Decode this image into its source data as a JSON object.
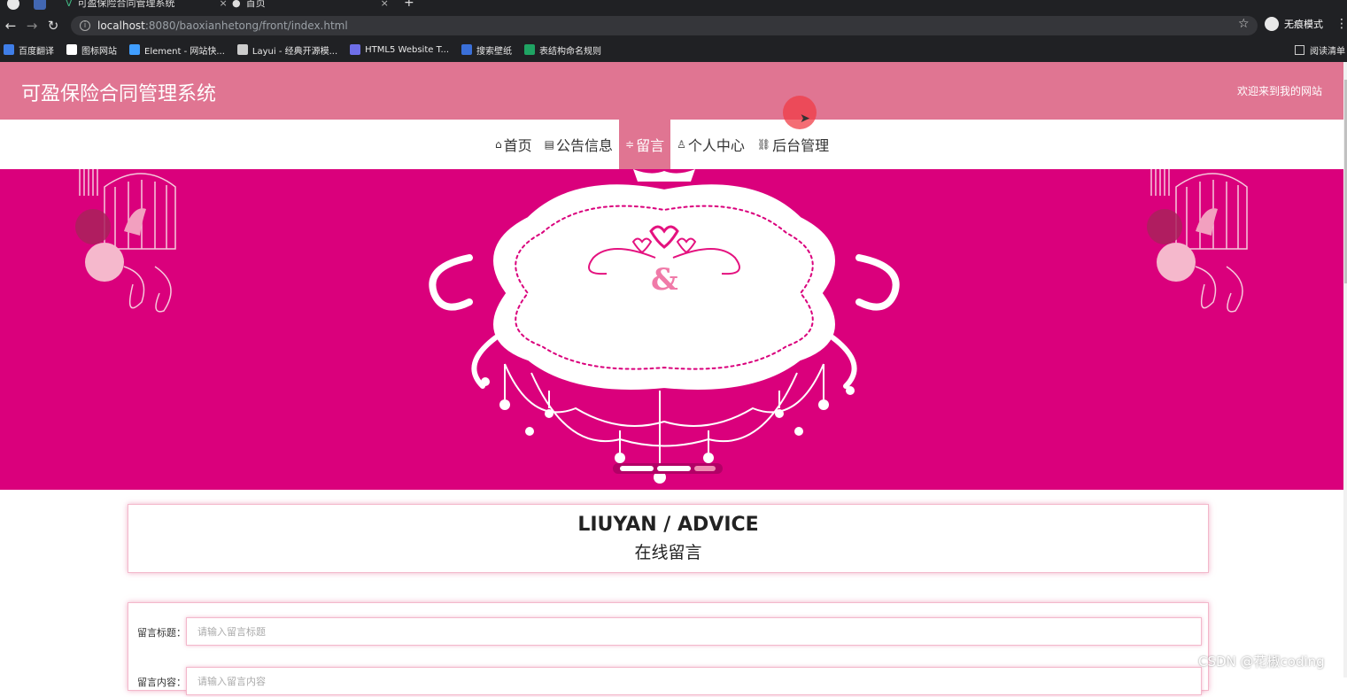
{
  "browser": {
    "tabs": [
      {
        "label": "可盈保险合同管理系统",
        "close": "×"
      },
      {
        "label": "首页",
        "close": "×"
      }
    ],
    "new_tab": "+",
    "nav": {
      "back": "←",
      "forward": "→",
      "reload": "↻"
    },
    "url_host": "localhost",
    "url_path": ":8080/baoxianhetong/front/index.html",
    "star": "☆",
    "incognito_label": "无痕模式",
    "menu": "⋮",
    "bookmarks": [
      {
        "label": "百度翻译",
        "color": "#3f7ee8"
      },
      {
        "label": "图标网站",
        "color": "#ffffff"
      },
      {
        "label": "Element - 网站快...",
        "color": "#409eff"
      },
      {
        "label": "Layui - 经典开源模...",
        "color": "#cccccc"
      },
      {
        "label": "HTML5 Website T...",
        "color": "#6e6ee8"
      },
      {
        "label": "搜索壁纸",
        "color": "#3a6fd8"
      },
      {
        "label": "表结构命名规则",
        "color": "#1fa463"
      }
    ],
    "reading_list": "阅读清单"
  },
  "site": {
    "title": "可盈保险合同管理系统",
    "welcome": "欢迎来到我的网站",
    "accent": "#e07592",
    "banner_color": "#da007c"
  },
  "nav": [
    {
      "icon": "⌂",
      "label": "首页",
      "active": false
    },
    {
      "icon": "▤",
      "label": "公告信息",
      "active": false
    },
    {
      "icon": "≑",
      "label": "留言",
      "active": true
    },
    {
      "icon": "♙",
      "label": "个人中心",
      "active": false
    },
    {
      "icon": "⛓",
      "label": "后台管理",
      "active": false
    }
  ],
  "carousel": {
    "count": 3,
    "active_index": 2
  },
  "section": {
    "en_title": "LIUYAN / ADVICE",
    "cn_title": "在线留言"
  },
  "form": {
    "title_label": "留言标题：",
    "title_placeholder": "请输入留言标题",
    "content_label": "留言内容：",
    "content_placeholder": "请输入留言内容"
  },
  "watermark": "CSDN @花椒coding"
}
